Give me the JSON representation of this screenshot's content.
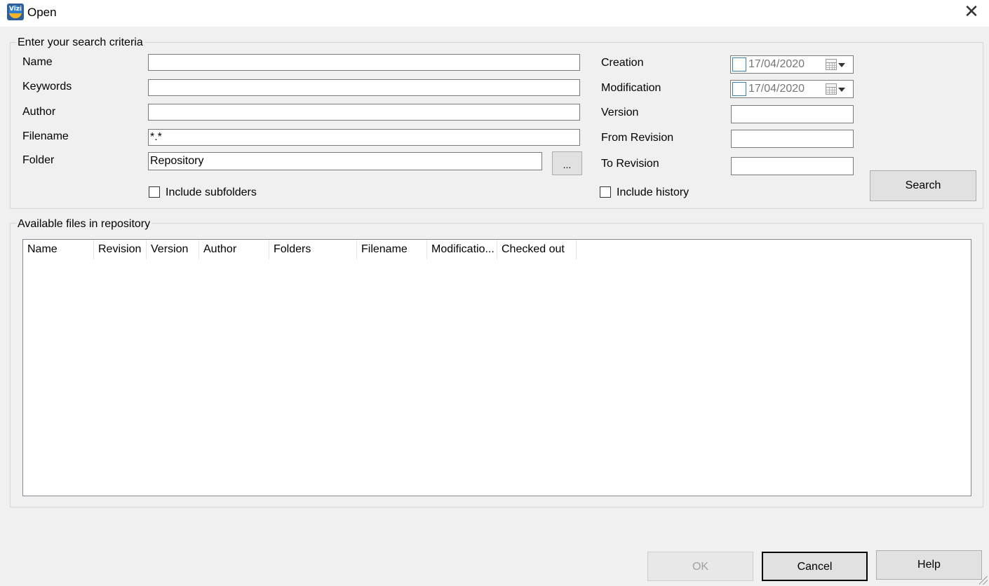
{
  "window": {
    "title": "Open",
    "close_glyph": "✕",
    "app_icon_text": "Vizi"
  },
  "criteria": {
    "legend": "Enter your search criteria",
    "name_label": "Name",
    "name_value": "",
    "keywords_label": "Keywords",
    "keywords_value": "",
    "author_label": "Author",
    "author_value": "",
    "filename_label": "Filename",
    "filename_value": "*.*",
    "folder_label": "Folder",
    "folder_value": "Repository",
    "browse_label": "...",
    "include_subfolders_label": "Include subfolders",
    "creation_label": "Creation",
    "creation_date": "17/04/2020",
    "modification_label": "Modification",
    "modification_date": "17/04/2020",
    "version_label": "Version",
    "version_value": "",
    "from_revision_label": "From Revision",
    "from_revision_value": "",
    "to_revision_label": "To Revision",
    "to_revision_value": "",
    "include_history_label": "Include history",
    "search_label": "Search"
  },
  "results": {
    "legend": "Available files in repository",
    "columns": [
      "Name",
      "Revision",
      "Version",
      "Author",
      "Folders",
      "Filename",
      "Modificatio...",
      "Checked out"
    ],
    "rows": []
  },
  "footer": {
    "ok_label": "OK",
    "cancel_label": "Cancel",
    "help_label": "Help"
  }
}
